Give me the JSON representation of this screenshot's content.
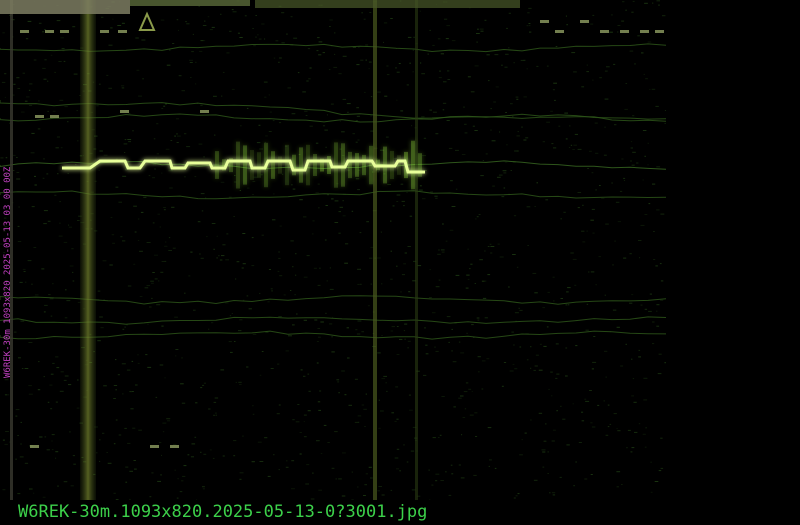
{
  "image": {
    "side_label": "W6REK-30m 1093x820 2025-05-13 03 00 00Z",
    "filename": "W6REK-30m.1093x820.2025-05-13-0?3001.jpg"
  },
  "colors": {
    "background": "#000000",
    "trace_bright": "#e8ff9a",
    "trace_mid": "#8fd43a",
    "trace_dim": "#2f5a1a",
    "noise": "#1d3a12",
    "band": "#6a7a2a",
    "top_band": "#8c8c6a",
    "label_magenta": "#c040c0",
    "filename_green": "#3cd04a"
  }
}
